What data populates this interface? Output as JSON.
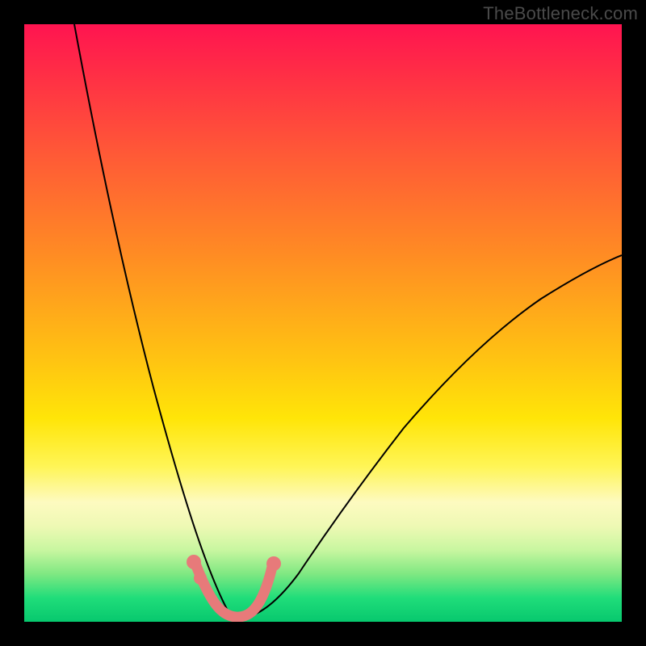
{
  "watermark": "TheBottleneck.com",
  "chart_data": {
    "type": "line",
    "title": "",
    "xlabel": "",
    "ylabel": "",
    "xlim": [
      0,
      100
    ],
    "ylim": [
      0,
      100
    ],
    "grid": false,
    "legend": false,
    "notes": "Stylized bottleneck curve: two branches descending to a minimum near x≈33. Background gradient encodes mismatch severity from red (high, top) to green (low, bottom). Salmon segment marks the near-zero bottleneck region around the minimum.",
    "series": [
      {
        "name": "left-branch",
        "x": [
          0,
          3,
          6,
          9,
          12,
          15,
          18,
          21,
          24,
          27,
          29,
          31,
          33,
          35
        ],
        "y": [
          100,
          88,
          76,
          65,
          54,
          44,
          35,
          26.5,
          18.5,
          11.5,
          7,
          3.5,
          1.2,
          0.5
        ]
      },
      {
        "name": "right-branch",
        "x": [
          35,
          38,
          42,
          47,
          52,
          58,
          64,
          70,
          76,
          82,
          88,
          94,
          100
        ],
        "y": [
          0.5,
          2,
          5,
          10,
          16,
          23,
          30,
          36.5,
          42.5,
          48,
          53,
          57.5,
          61.3
        ]
      },
      {
        "name": "optimal-region",
        "x": [
          27,
          29,
          31,
          33,
          35,
          37,
          39,
          41
        ],
        "y": [
          9.5,
          4,
          1.5,
          0.7,
          0.5,
          1.2,
          3.5,
          8
        ]
      }
    ],
    "markers": [
      {
        "name": "left-knee-dot-1",
        "x": 27,
        "y": 9.5
      },
      {
        "name": "left-knee-dot-2",
        "x": 28.5,
        "y": 6.5
      },
      {
        "name": "right-knee-dot",
        "x": 41,
        "y": 8.5
      }
    ],
    "colors": {
      "curve": "#000000",
      "optimal_region": "#e77a7a",
      "gradient_top": "#ff1450",
      "gradient_mid": "#ffe508",
      "gradient_bottom": "#07c86e"
    }
  }
}
